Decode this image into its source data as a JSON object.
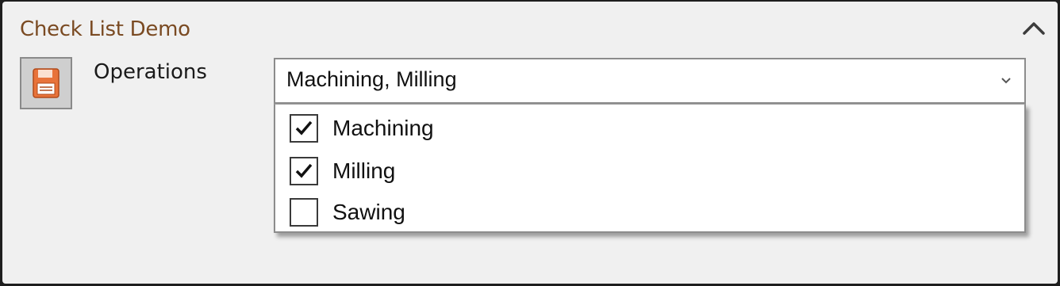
{
  "panel": {
    "title": "Check List Demo",
    "collapse_icon": "chevron-up-icon",
    "save_icon": "floppy-disk-icon"
  },
  "field": {
    "label": "Operations",
    "selected_text": "Machining, Milling",
    "dropdown_icon": "chevron-down-icon"
  },
  "options": [
    {
      "label": "Machining",
      "checked": true
    },
    {
      "label": "Milling",
      "checked": true
    },
    {
      "label": "Sawing",
      "checked": false
    }
  ],
  "colors": {
    "title": "#7a4a22",
    "save_icon": "#e8733a"
  }
}
